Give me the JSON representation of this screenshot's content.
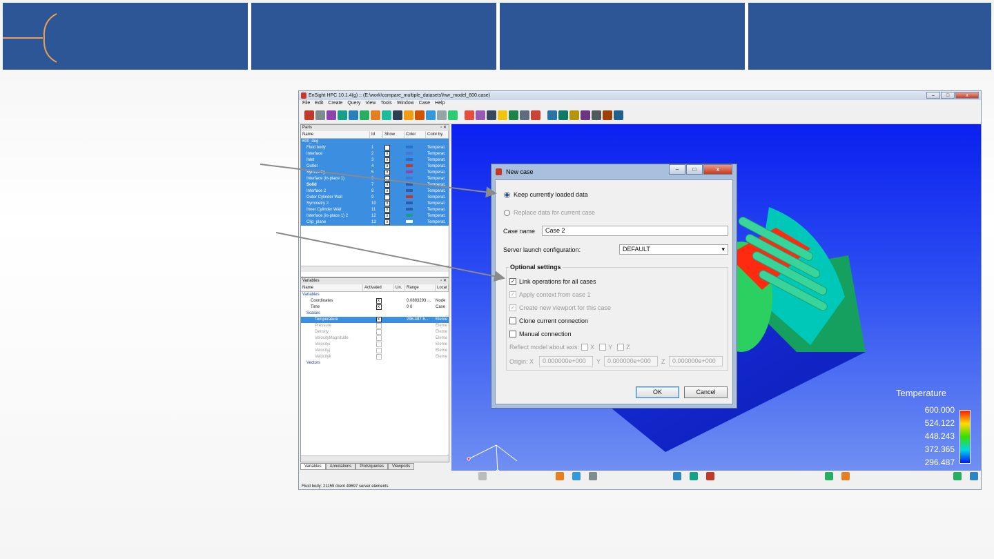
{
  "colors": {
    "header_blue": "#2c5696",
    "accent_orange": "#f0a050",
    "selection_blue": "#3b8ee0"
  },
  "app": {
    "title": "EnSight HPC 10.1.4(g) :: (E:\\work\\compare_multiple_datasets\\hwr_model_600.case)",
    "window_controls": [
      "–",
      "□",
      "x"
    ],
    "menu": [
      "File",
      "Edit",
      "Create",
      "Query",
      "View",
      "Tools",
      "Window",
      "Case",
      "Help"
    ],
    "parts_panel": {
      "title": "Parts",
      "columns": [
        "Name",
        "Id",
        "Show",
        "Color",
        "Color by"
      ],
      "group": "600_deg",
      "rows": [
        {
          "name": "Fluid body",
          "id": "1",
          "show": "",
          "color": "#2a6fd0",
          "by": "Temperat."
        },
        {
          "name": "Interface",
          "id": "2",
          "show": "x",
          "color": "#3b7bd6",
          "by": "Temperat."
        },
        {
          "name": "Inlet",
          "id": "3",
          "show": "x",
          "color": "#2f69c7",
          "by": "Temperat."
        },
        {
          "name": "Outlet",
          "id": "4",
          "show": "x",
          "color": "#c0392b",
          "by": "Temperat."
        },
        {
          "name": "Symmetry",
          "id": "5",
          "show": "x",
          "color": "#8e44ad",
          "by": "Temperat."
        },
        {
          "name": "Interface (in-place 1)",
          "id": "6",
          "show": "",
          "color": "#3b7bd6",
          "by": "Temperat."
        },
        {
          "name": "Solid",
          "id": "7",
          "show": "x",
          "color": "#2a5db0",
          "by": "Temperat."
        },
        {
          "name": "Interface 2",
          "id": "8",
          "show": "x",
          "color": "#2a5db0",
          "by": "Temperat."
        },
        {
          "name": "Outer Cylinder Wall",
          "id": "9",
          "show": "",
          "color": "#c0392b",
          "by": "Temperat."
        },
        {
          "name": "Symmetry 2",
          "id": "10",
          "show": "x",
          "color": "#2a5db0",
          "by": "Temperat."
        },
        {
          "name": "Inner Cylinder Wall",
          "id": "11",
          "show": "x",
          "color": "#2a5db0",
          "by": "Temperat."
        },
        {
          "name": "Interface (in-place 1) 2",
          "id": "12",
          "show": "x",
          "color": "#1c9a8a",
          "by": "Temperat."
        },
        {
          "name": "Clip_plane",
          "id": "13",
          "show": "x",
          "color": "#ffffff",
          "by": "Temperat."
        }
      ]
    },
    "variables_panel": {
      "title": "Variables",
      "columns": [
        "Name",
        "Activated",
        "Un.",
        "Range",
        "Locat"
      ],
      "rows": [
        {
          "indent": 0,
          "name": "Variables",
          "act": "",
          "range": "",
          "loc": "",
          "cls": "group"
        },
        {
          "indent": 2,
          "name": "Coordinates",
          "act": "x",
          "range": "0.0893293 ...",
          "loc": "Node",
          "cls": ""
        },
        {
          "indent": 2,
          "name": "Time",
          "act": "x",
          "range": "0   0",
          "loc": "Case",
          "cls": ""
        },
        {
          "indent": 1,
          "name": "Scalars",
          "act": "",
          "range": "",
          "loc": "",
          "cls": "group"
        },
        {
          "indent": 3,
          "name": "Temperature",
          "act": "x",
          "range": "296.487   6...",
          "loc": "Eleme",
          "cls": "sel"
        },
        {
          "indent": 3,
          "name": "Pressure",
          "act": "o",
          "range": "",
          "loc": "Eleme",
          "cls": "dim"
        },
        {
          "indent": 3,
          "name": "Density",
          "act": "o",
          "range": "",
          "loc": "Eleme",
          "cls": "dim"
        },
        {
          "indent": 3,
          "name": "VelocityMagnitude",
          "act": "o",
          "range": "",
          "loc": "Eleme",
          "cls": "dim"
        },
        {
          "indent": 3,
          "name": "Velocityi",
          "act": "o",
          "range": "",
          "loc": "Eleme",
          "cls": "dim"
        },
        {
          "indent": 3,
          "name": "Velocityj",
          "act": "o",
          "range": "",
          "loc": "Eleme",
          "cls": "dim"
        },
        {
          "indent": 3,
          "name": "Velocityk",
          "act": "o",
          "range": "",
          "loc": "Eleme",
          "cls": "dim"
        },
        {
          "indent": 1,
          "name": "Vectors",
          "act": "",
          "range": "",
          "loc": "",
          "cls": "group"
        }
      ]
    },
    "tabs": [
      "Variables",
      "Annotations",
      "Plots/queries",
      "Viewports"
    ],
    "status": "Fluid body: 21159 client 49697 server elements"
  },
  "legend": {
    "title": "Temperature",
    "values": [
      "600.000",
      "524.122",
      "448.243",
      "372.365",
      "296.487"
    ]
  },
  "dialog": {
    "title": "New case",
    "radio_keep": "Keep currently loaded data",
    "radio_replace": "Replace data for current case",
    "case_name_label": "Case name",
    "case_name_value": "Case 2",
    "server_label": "Server launch configuration:",
    "server_value": "DEFAULT",
    "optional_title": "Optional settings",
    "opt_link": "Link operations for all cases",
    "opt_apply": "Apply context from case 1",
    "opt_viewport": "Create new viewport for this case",
    "opt_clone": "Clone current connection",
    "opt_manual": "Manual connection",
    "reflect_label": "Reflect model about axis:",
    "axis_x": "X",
    "axis_y": "Y",
    "axis_z": "Z",
    "origin_label": "Origin: X",
    "origin_x": "0.000000e+000",
    "origin_y_label": "Y",
    "origin_y": "0.000000e+000",
    "origin_z_label": "Z",
    "origin_z": "0.000000e+000",
    "ok": "OK",
    "cancel": "Cancel"
  }
}
